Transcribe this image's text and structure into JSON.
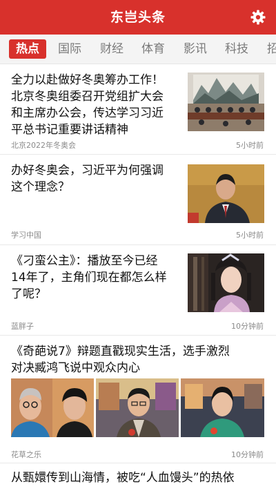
{
  "app": {
    "title": "东岂头条",
    "settings_icon": "gear-icon"
  },
  "tabs": [
    {
      "label": "热点",
      "active": true
    },
    {
      "label": "国际"
    },
    {
      "label": "财经"
    },
    {
      "label": "体育"
    },
    {
      "label": "影讯"
    },
    {
      "label": "科技"
    },
    {
      "label": "招"
    }
  ],
  "colors": {
    "brand": "#d8312c",
    "tab_inactive": "#7a7a7a",
    "meta": "#8a8a8a"
  },
  "articles": [
    {
      "title_lines": [
        "全力以赴做好冬奥筹办工作！",
        "北京冬奥组委召开党组扩大会",
        "和主席办公会，传达学习习近",
        "平总书记重要讲话精神"
      ],
      "source": "北京2022年冬奥会",
      "time": "5小时前"
    },
    {
      "title_lines": [
        "办好冬奥会，习近平为何强调",
        "这个理念？"
      ],
      "source": "学习中国",
      "time": "5小时前"
    },
    {
      "title_lines": [
        "《刁蛮公主》：播放至今已经",
        "14年了，主角们现在都怎么样",
        "了呢？"
      ],
      "source": "蓝胖子",
      "time": "10分钟前"
    },
    {
      "title_lines": [
        "《奇葩说7》辩题直戳现实生活，选手激烈",
        "对决臧鸿飞说中观众内心"
      ],
      "source": "花草之乐",
      "time": "10分钟前"
    },
    {
      "title_lines": [
        "从甄嬛传到山海情，被吃“人血馒头”的热依"
      ]
    }
  ]
}
